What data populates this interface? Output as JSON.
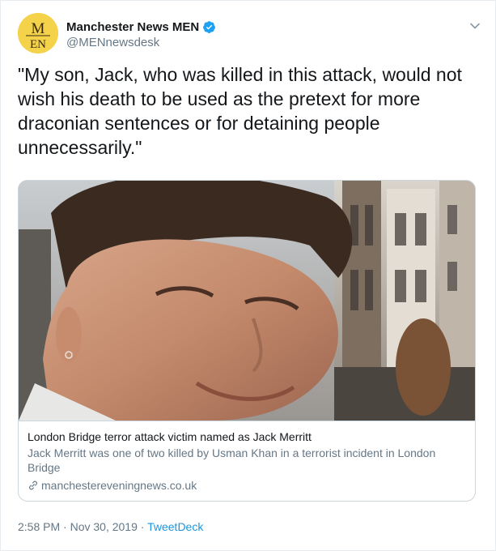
{
  "author": {
    "display_name": "Manchester News MEN",
    "handle": "@MENnewsdesk",
    "avatar_text_top": "M",
    "avatar_text_bottom": "EN",
    "verified": true
  },
  "tweet": {
    "text": "\"My son, Jack, who was killed in this attack, would not wish his death to be used as the pretext for more draconian sentences or for detaining people unnecessarily.\""
  },
  "card": {
    "title": "London Bridge terror attack victim named as Jack Merritt",
    "description": "Jack Merritt was one of two killed by Usman Khan in a terrorist incident in London Bridge",
    "domain": "manchestereveningnews.co.uk"
  },
  "meta": {
    "time": "2:58 PM",
    "separator": "·",
    "date": "Nov 30, 2019",
    "source": "TweetDeck"
  },
  "colors": {
    "avatar_bg": "#f4d24a",
    "verified": "#1da1f2",
    "link_blue": "#1b95e0",
    "muted": "#657786",
    "text": "#14171a",
    "border": "#ccd6dd"
  },
  "icons": {
    "verified": "verified-badge-icon",
    "chevron": "chevron-down-icon",
    "link": "link-icon"
  }
}
